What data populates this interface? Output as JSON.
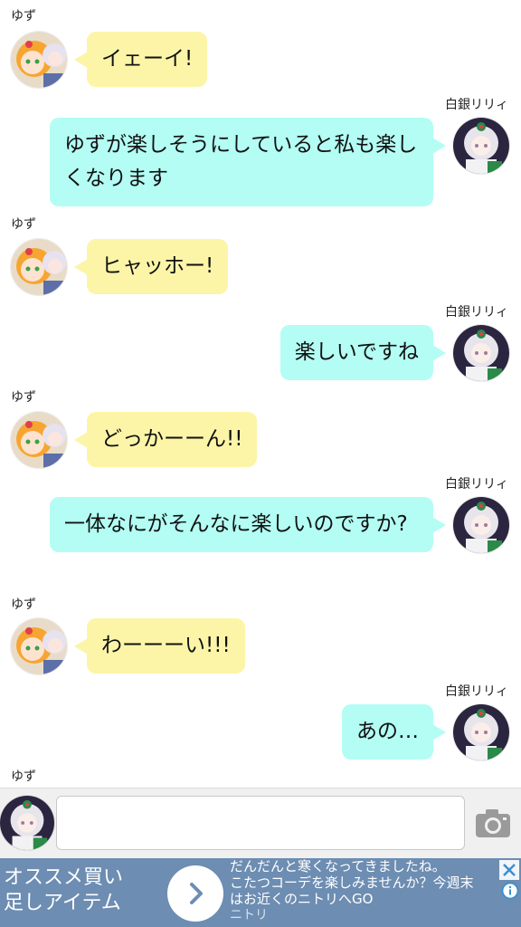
{
  "participants": {
    "yuzu": {
      "name": "ゆず"
    },
    "lily": {
      "name": "白銀リリィ"
    }
  },
  "messages": [
    {
      "speaker": "yuzu",
      "text": "イェーイ!"
    },
    {
      "speaker": "lily",
      "text": "ゆずが楽しそうにしていると私も楽しくなります"
    },
    {
      "speaker": "yuzu",
      "text": "ヒャッホー!"
    },
    {
      "speaker": "lily",
      "text": "楽しいですね"
    },
    {
      "speaker": "yuzu",
      "text": "どっかーーん!!"
    },
    {
      "speaker": "lily",
      "text": "一体なにがそんなに楽しいのですか?"
    },
    {
      "speaker": "yuzu",
      "text": "わーーーい!!!"
    },
    {
      "speaker": "lily",
      "text": "あの…"
    }
  ],
  "pending_speaker": {
    "name": "ゆず"
  },
  "composer": {
    "camera_icon": "camera-icon",
    "avatar": "lily"
  },
  "ad": {
    "headline_line1": "オススメ買い",
    "headline_line2": "足しアイテム",
    "body_line1": "だんだんと寒くなってきましたね。",
    "body_line2": "こたつコーデを楽しみませんか？今週末",
    "body_line3": "はお近くのニトリへGO",
    "brand": "ニトリ",
    "cta_icon": "chevron-right-icon",
    "close_icon": "close-icon",
    "info_icon": "info-icon"
  },
  "colors": {
    "yuzu_bubble": "#fcf5a8",
    "lily_bubble": "#b3fdf4",
    "ad_background": "#6d8db2"
  }
}
